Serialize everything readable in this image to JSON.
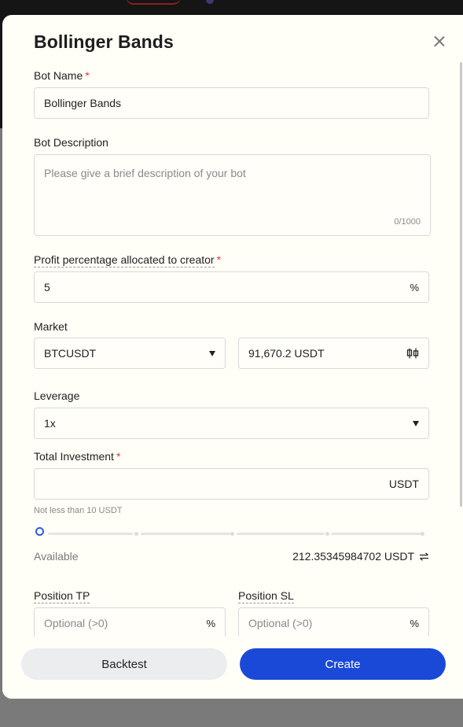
{
  "modal": {
    "title": "Bollinger Bands",
    "bot_name": {
      "label": "Bot Name",
      "required_mark": "*",
      "value": "Bollinger Bands"
    },
    "bot_description": {
      "label": "Bot Description",
      "placeholder": "Please give a brief description of your bot",
      "counter": "0/1000"
    },
    "profit_share": {
      "label": "Profit percentage allocated to creator",
      "required_mark": "*",
      "value": "5",
      "suffix": "%"
    },
    "market": {
      "label": "Market",
      "symbol": "BTCUSDT",
      "price": "91,670.2 USDT",
      "price_icon": "candlestick-icon"
    },
    "leverage": {
      "label": "Leverage",
      "value": "1x"
    },
    "investment": {
      "label": "Total Investment",
      "required_mark": "*",
      "suffix": "USDT",
      "hint": "Not less than 10 USDT",
      "slider_percent": 0
    },
    "available": {
      "label": "Available",
      "value": "212.35345984702 USDT",
      "icon": "swap-icon"
    },
    "position_tp": {
      "label": "Position TP",
      "placeholder": "Optional (>0)",
      "suffix": "%"
    },
    "position_sl": {
      "label": "Position SL",
      "placeholder": "Optional (>0)",
      "suffix": "%"
    },
    "buttons": {
      "backtest": "Backtest",
      "create": "Create"
    }
  },
  "colors": {
    "accent": "#1a49d8",
    "required": "#e53935",
    "modal_bg": "#fffef7"
  }
}
